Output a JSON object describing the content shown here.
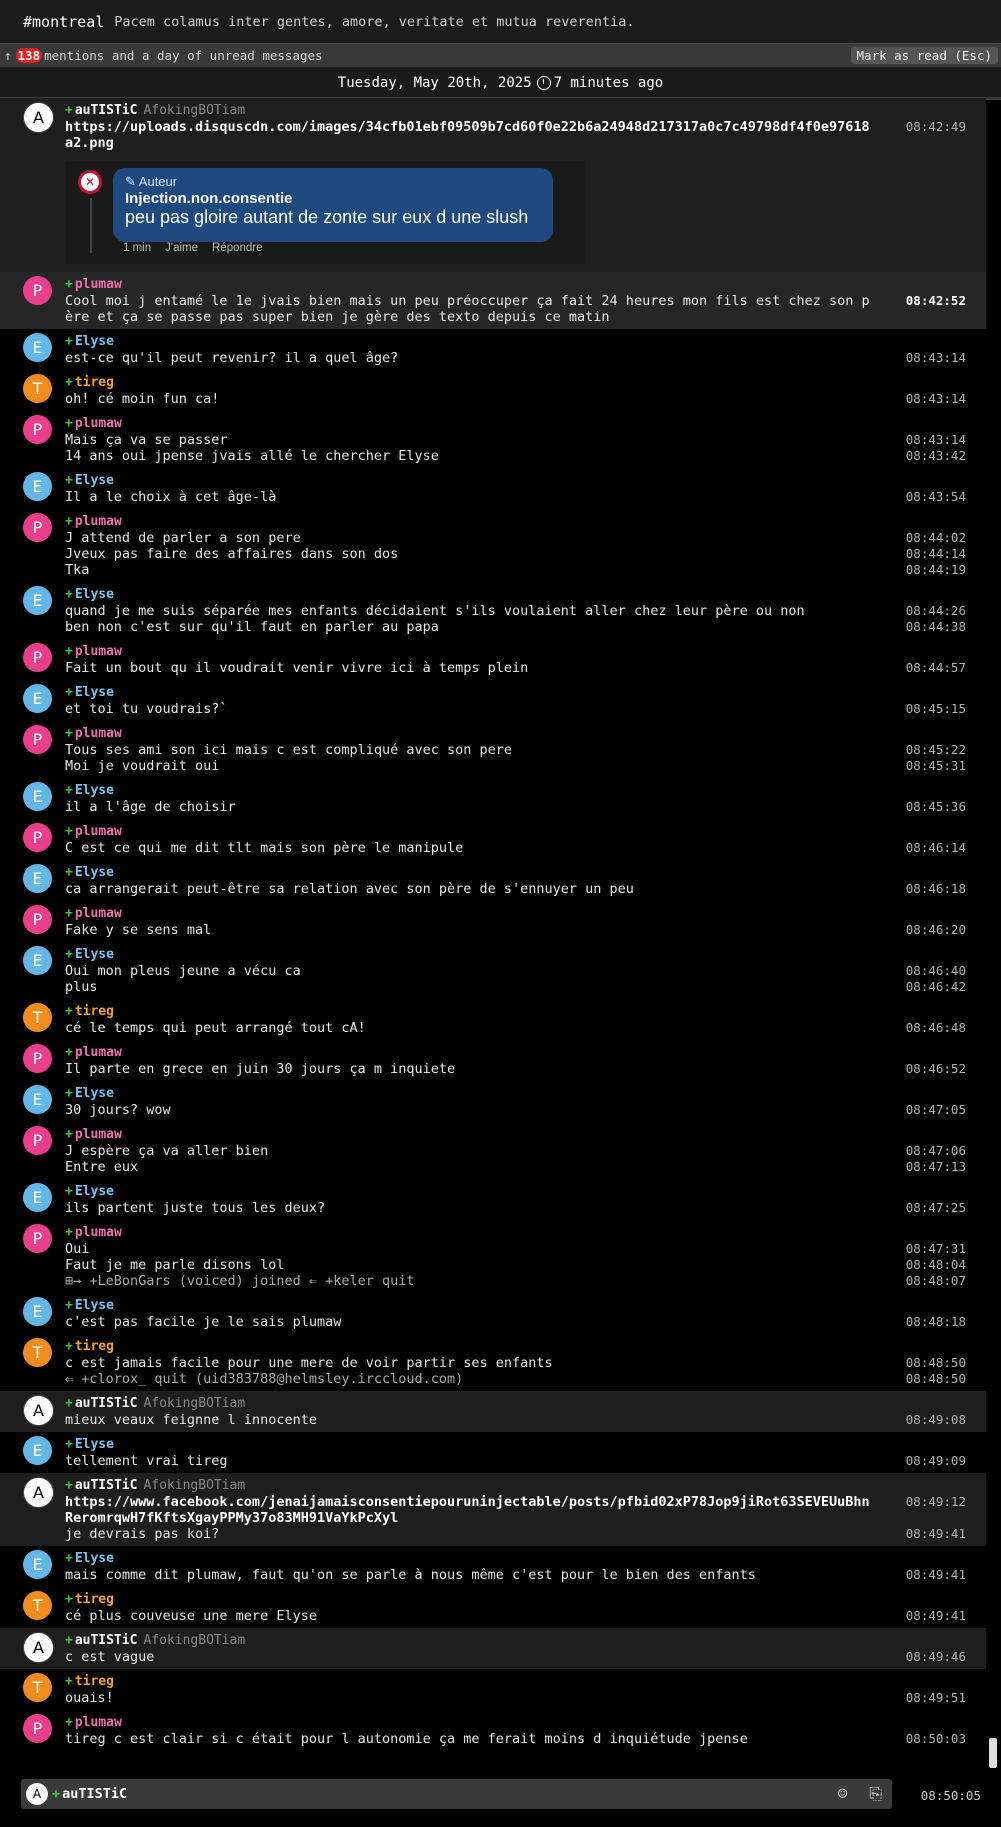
{
  "topic": {
    "channel": "#montreal",
    "text": "Pacem colamus inter gentes, amore, veritate et mutua reverentia."
  },
  "unread": {
    "arrow": "↑",
    "count": "138",
    "text": "mentions and a day of unread messages",
    "mark_label": "Mark as read (Esc)"
  },
  "datebar": {
    "date": "Tuesday, May 20th, 2025",
    "relative": "7 minutes ago"
  },
  "embed": {
    "role": "✎ Auteur",
    "author": "Injection.non.consentie",
    "text": "peu pas gloire autant de zonte sur eux d une slush",
    "time": "1 min",
    "like": "J'aime",
    "reply": "Répondre"
  },
  "msgs": [
    {
      "nick": "auTISTiC",
      "bot": "AfokingBOTiam",
      "lines": [
        {
          "t": "https://uploads.disquscdn.com/images/34cfb01ebf09509b7cd60f0e22b6a24948d217317a0c7c49798df4f0e97618a2.png",
          "ts": "08:42:49"
        }
      ]
    },
    {
      "nick": "plumaw",
      "lines": [
        {
          "t": "Cool moi j entamé le 1e jvais bien mais un peu préoccuper ça fait 24 heures mon fils est chez son père et ça se passe pas super bien je gère des texto depuis ce matin",
          "ts": "08:42:52"
        }
      ]
    },
    {
      "nick": "Elyse",
      "lines": [
        {
          "t": "est-ce qu'il peut revenir? il a quel âge?",
          "ts": "08:43:14"
        }
      ]
    },
    {
      "nick": "tireg",
      "lines": [
        {
          "t": "oh! cé moin fun ca!",
          "ts": "08:43:14"
        }
      ]
    },
    {
      "nick": "plumaw",
      "lines": [
        {
          "t": "Mais ça va se passer",
          "ts": "08:43:14"
        },
        {
          "t": "14 ans oui jpense jvais allé le chercher Elyse",
          "ts": "08:43:42"
        }
      ]
    },
    {
      "nick": "Elyse",
      "lines": [
        {
          "t": "Il a le choix à cet âge-là",
          "ts": "08:43:54"
        }
      ]
    },
    {
      "nick": "plumaw",
      "lines": [
        {
          "t": "J attend de parler a son pere",
          "ts": "08:44:02"
        },
        {
          "t": "Jveux pas faire des affaires dans son dos",
          "ts": "08:44:14"
        },
        {
          "t": "Tka",
          "ts": "08:44:19"
        }
      ]
    },
    {
      "nick": "Elyse",
      "lines": [
        {
          "t": "quand je me suis séparée mes enfants décidaient s'ils voulaient aller chez leur père ou non",
          "ts": "08:44:26"
        },
        {
          "t": "ben non c'est sur qu'il faut en parler au papa",
          "ts": "08:44:38"
        }
      ]
    },
    {
      "nick": "plumaw",
      "lines": [
        {
          "t": "Fait un bout qu il voudrait venir vivre ici à temps plein",
          "ts": "08:44:57"
        }
      ]
    },
    {
      "nick": "Elyse",
      "lines": [
        {
          "t": "et toi tu voudrais?`",
          "ts": "08:45:15"
        }
      ]
    },
    {
      "nick": "plumaw",
      "lines": [
        {
          "t": "Tous ses ami son ici mais c est compliqué avec son pere",
          "ts": "08:45:22"
        },
        {
          "t": "Moi je voudrait oui",
          "ts": "08:45:31"
        }
      ]
    },
    {
      "nick": "Elyse",
      "lines": [
        {
          "t": "il a l'âge de choisir",
          "ts": "08:45:36"
        }
      ]
    },
    {
      "nick": "plumaw",
      "lines": [
        {
          "t": "C est ce qui me dit tlt mais son père le manipule",
          "ts": "08:46:14"
        }
      ]
    },
    {
      "nick": "Elyse",
      "lines": [
        {
          "t": "ca arrangerait peut-être sa relation avec son père de s'ennuyer un peu",
          "ts": "08:46:18"
        }
      ]
    },
    {
      "nick": "plumaw",
      "lines": [
        {
          "t": "Fake y se sens mal",
          "ts": "08:46:20"
        }
      ]
    },
    {
      "nick": "Elyse",
      "lines": [
        {
          "t": "Oui mon pleus jeune a vécu ca",
          "ts": "08:46:40"
        },
        {
          "t": "plus",
          "ts": "08:46:42"
        }
      ]
    },
    {
      "nick": "tireg",
      "lines": [
        {
          "t": "cé le temps qui peut arrangé tout cA!",
          "ts": "08:46:48"
        }
      ]
    },
    {
      "nick": "plumaw",
      "lines": [
        {
          "t": "Il parte en grece en juin 30 jours ça m inquiete",
          "ts": "08:46:52"
        }
      ]
    },
    {
      "nick": "Elyse",
      "lines": [
        {
          "t": "30 jours? wow",
          "ts": "08:47:05"
        }
      ]
    },
    {
      "nick": "plumaw",
      "lines": [
        {
          "t": "J espère ça va aller bien",
          "ts": "08:47:06"
        },
        {
          "t": "Entre eux",
          "ts": "08:47:13"
        }
      ]
    },
    {
      "nick": "Elyse",
      "lines": [
        {
          "t": "ils partent juste tous les deux?",
          "ts": "08:47:25"
        }
      ]
    },
    {
      "nick": "plumaw",
      "lines": [
        {
          "t": "Oui",
          "ts": "08:47:31"
        },
        {
          "t": "Faut je me parle disons lol",
          "ts": "08:48:04"
        },
        {
          "t": "⊞→ +LeBonGars (voiced) joined  ⇐ +keler quit",
          "ts": "08:48:07",
          "sys": true
        }
      ]
    },
    {
      "nick": "Elyse",
      "lines": [
        {
          "t": "c'est pas facile je le sais plumaw",
          "ts": "08:48:18"
        }
      ]
    },
    {
      "nick": "tireg",
      "lines": [
        {
          "t": "c est jamais facile pour une mere de voir partir ses enfants",
          "ts": "08:48:50"
        },
        {
          "t": "⇐ +clorox_ quit (uid383788@helmsley.irccloud.com)",
          "ts": "08:48:50",
          "sys": true
        }
      ]
    },
    {
      "nick": "auTISTiC",
      "bot": "AfokingBOTiam",
      "lines": [
        {
          "t": "mieux veaux feignne l innocente",
          "ts": "08:49:08"
        }
      ]
    },
    {
      "nick": "Elyse",
      "lines": [
        {
          "t": "tellement vrai tireg",
          "ts": "08:49:09"
        }
      ]
    },
    {
      "nick": "auTISTiC",
      "bot": "AfokingBOTiam",
      "lines": [
        {
          "t": "https://www.facebook.com/jenaijamaisconsentiepouruninjectable/posts/pfbid02xP78Jop9jiRot63SEVEUuBhnReromrqwH7fKftsXgayPPMy37o83MH91VaYkPcXyl",
          "ts": "08:49:12",
          "link": true
        },
        {
          "t": "je devrais pas koi?",
          "ts": "08:49:41"
        }
      ]
    },
    {
      "nick": "Elyse",
      "lines": [
        {
          "t": "mais comme dit plumaw, faut qu'on se parle à nous même c'est pour le bien des enfants",
          "ts": "08:49:41"
        }
      ]
    },
    {
      "nick": "tireg",
      "lines": [
        {
          "t": "cé plus couveuse  une mere Elyse",
          "ts": "08:49:41"
        }
      ]
    },
    {
      "nick": "auTISTiC",
      "bot": "AfokingBOTiam",
      "lines": [
        {
          "t": "c est vague",
          "ts": "08:49:46"
        }
      ]
    },
    {
      "nick": "tireg",
      "lines": [
        {
          "t": "ouais!",
          "ts": "08:49:51"
        }
      ]
    },
    {
      "nick": "plumaw",
      "lines": [
        {
          "t": "tireg c est clair si c était pour l autonomie ça me ferait moins d inquiétude jpense",
          "ts": "08:50:03"
        }
      ]
    }
  ],
  "composer": {
    "nick": "auTISTiC",
    "avatar": "A",
    "time": "08:50:05",
    "emoji_icon": "☺",
    "paste_icon": "⎘"
  },
  "colors": {
    "plumaw": "#f06fb0",
    "Elyse": "#75c2f0",
    "tireg": "#f4a02c",
    "auTISTiC": "#ffffff",
    "joined": "#3cc83c",
    "unread_badge": "#e02020"
  }
}
